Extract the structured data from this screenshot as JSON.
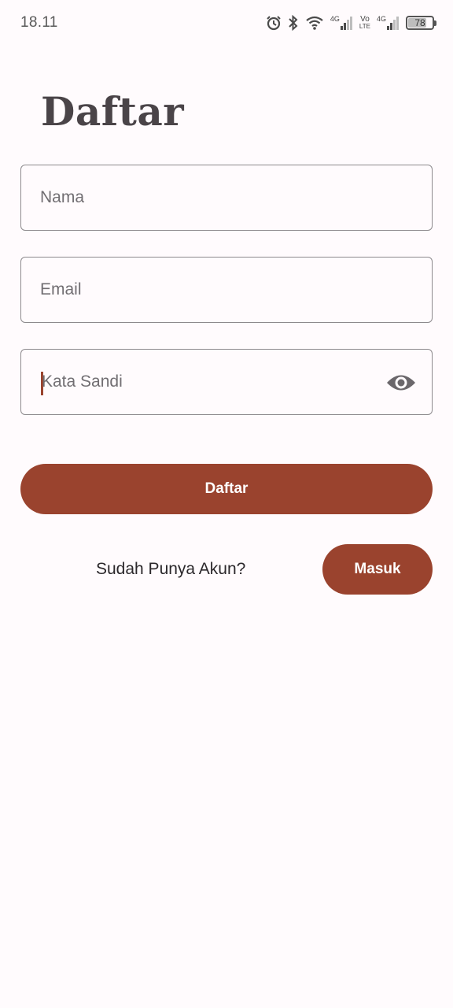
{
  "status_bar": {
    "time": "18.11",
    "icons": [
      "alarm-icon",
      "bluetooth-icon",
      "wifi-icon",
      "signal-icon",
      "signal-icon"
    ],
    "network_1": "4G",
    "volte_top": "Vo",
    "volte_bottom": "LTE",
    "network_2": "4G",
    "battery_level": "78"
  },
  "page": {
    "title": "Daftar"
  },
  "form": {
    "name_placeholder": "Nama",
    "email_placeholder": "Email",
    "password_placeholder": "Kata Sandi",
    "password_toggle_icon": "eye-icon",
    "submit_label": "Daftar"
  },
  "login": {
    "prompt": "Sudah Punya Akun?",
    "button_label": "Masuk"
  },
  "colors": {
    "accent": "#9a432e",
    "background": "#fffbfd",
    "title": "#4a4448",
    "outline": "#8d8a8d"
  }
}
